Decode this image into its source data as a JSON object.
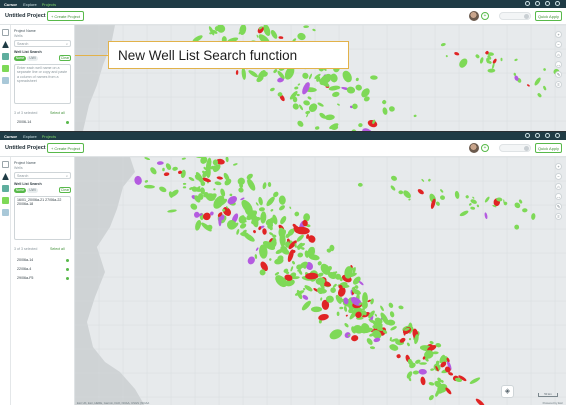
{
  "app": {
    "brand": "Cursor",
    "nav": [
      "Explore",
      "Projects"
    ],
    "active_nav": "Projects"
  },
  "project": {
    "title": "Untitled Project",
    "create_label": "+ Create Project",
    "quick_apply_label": "Quick Apply"
  },
  "panel": {
    "heading": "Project Name",
    "subheading": "Wells",
    "search_placeholder": "Search",
    "list_search_label": "Well List Search",
    "pill_on": "Name",
    "pill_off": "UWI",
    "clear_label": "Clear",
    "textarea_hint": "Enter each well name on a separate line or copy and paste a column of names from a spreadsheet",
    "textarea_value": "16/01_20/06a-21 27/06a-22 20/06a-18",
    "results_label": "3 of 3 selected",
    "select_all": "Select all",
    "first_result_partial": "20/06-14",
    "results": [
      "20/06a-14",
      "22/06a-4",
      "29/06a-F5"
    ]
  },
  "callout": {
    "text": "New Well List Search function"
  },
  "map": {
    "attribution": "Esri UK, Esri, HERE, Garmin, FAO, NOAA, USGS | NOAA",
    "powered_by": "Powered by Esri",
    "scale_label": "50 km",
    "colors": {
      "water": "#e7eaec",
      "land": "#cfd3d5",
      "green": "#7ed957",
      "purple": "#b45be0",
      "red": "#e02424",
      "accent": "#58b94a",
      "header": "#1f3b45",
      "callout_border": "#e2b24a"
    }
  }
}
